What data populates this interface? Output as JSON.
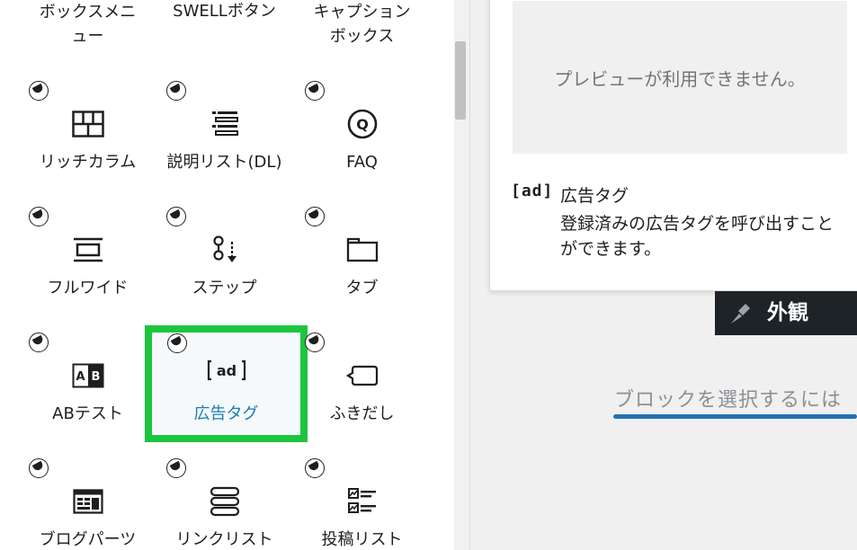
{
  "inserter": {
    "top_row": [
      {
        "label": "ボックスメニュー",
        "icon": "box-menu-icon"
      },
      {
        "label": "SWELLボタン",
        "icon": "button-icon"
      },
      {
        "label": "キャプションボックス",
        "icon": "caption-box-icon"
      }
    ],
    "blocks": [
      {
        "label": "リッチカラム",
        "icon": "rich-columns-icon"
      },
      {
        "label": "説明リスト(DL)",
        "icon": "description-list-icon"
      },
      {
        "label": "FAQ",
        "icon": "faq-icon"
      },
      {
        "label": "フルワイド",
        "icon": "full-wide-icon"
      },
      {
        "label": "ステップ",
        "icon": "step-icon"
      },
      {
        "label": "タブ",
        "icon": "tab-icon"
      },
      {
        "label": "ABテスト",
        "icon": "ab-test-icon"
      },
      {
        "label": "広告タグ",
        "icon": "ad-tag-icon",
        "selected": true
      },
      {
        "label": "ふきだし",
        "icon": "speech-balloon-icon"
      },
      {
        "label": "ブログパーツ",
        "icon": "blog-parts-icon"
      },
      {
        "label": "リンクリスト",
        "icon": "link-list-icon"
      },
      {
        "label": "投稿リスト",
        "icon": "post-list-icon"
      }
    ],
    "badge_icon": "swell-badge-icon",
    "top_row_label_1": "ボックスメニ",
    "top_row_label_2": "ュー",
    "top_row_label_3": "SWELLボタン",
    "top_row_label_4": "キャプション",
    "top_row_label_5": "ボックス"
  },
  "preview": {
    "unavailable": "プレビューが利用できません。",
    "icon_text": "[ad]",
    "title": "広告タグ",
    "description": "登録済みの広告タグを呼び出すことができます。"
  },
  "admin_menu": {
    "label": "外観",
    "icon": "paintbrush-icon"
  },
  "editor": {
    "hint": "ブロックを選択するには"
  },
  "colors": {
    "selection_outline": "#1dc53f",
    "selected_label": "#1b7dae",
    "accent": "#2271b1"
  }
}
